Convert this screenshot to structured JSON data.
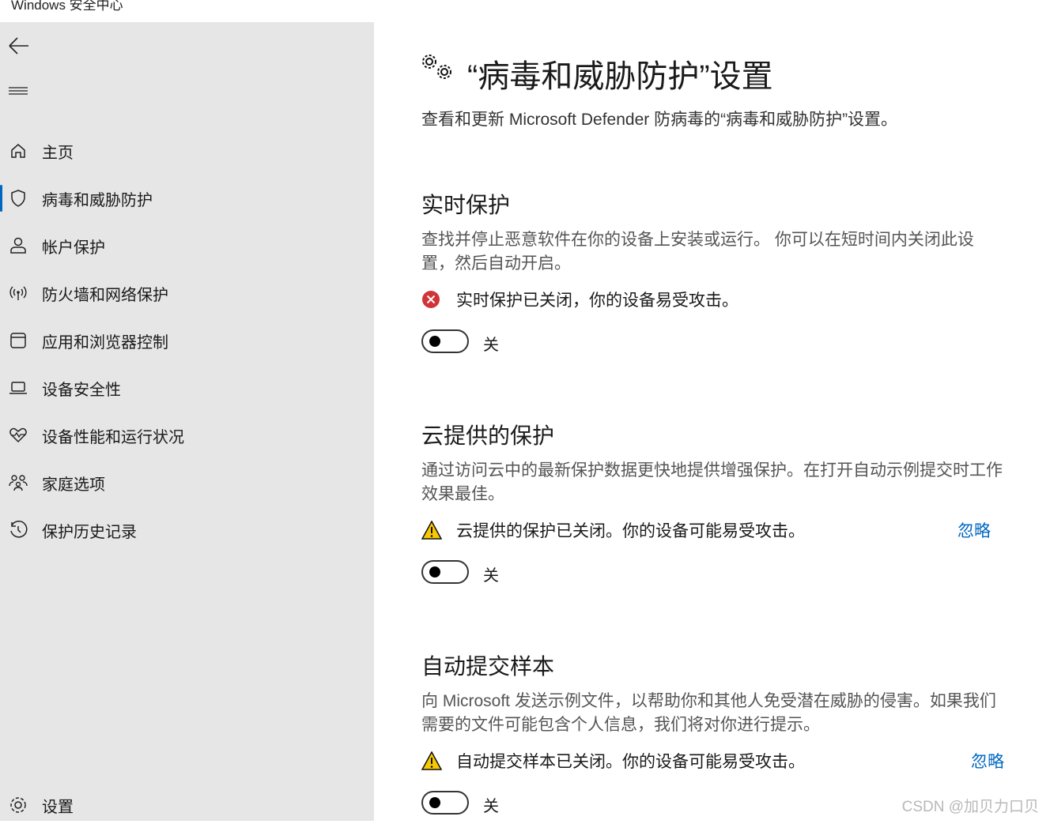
{
  "window": {
    "title": "Windows 安全中心"
  },
  "sidebar": {
    "items": [
      {
        "label": "主页",
        "icon": "home-icon"
      },
      {
        "label": "病毒和威胁防护",
        "icon": "shield-icon",
        "selected": true
      },
      {
        "label": "帐户保护",
        "icon": "person-icon"
      },
      {
        "label": "防火墙和网络保护",
        "icon": "wireless-icon"
      },
      {
        "label": "应用和浏览器控制",
        "icon": "app-window-icon"
      },
      {
        "label": "设备安全性",
        "icon": "laptop-icon"
      },
      {
        "label": "设备性能和运行状况",
        "icon": "heart-pulse-icon"
      },
      {
        "label": "家庭选项",
        "icon": "family-icon"
      },
      {
        "label": "保护历史记录",
        "icon": "history-icon"
      }
    ],
    "settings": "设置"
  },
  "main": {
    "title": "“病毒和威胁防护”设置",
    "subtitle": "查看和更新 Microsoft Defender 防病毒的“病毒和威胁防护”设置。",
    "sections": [
      {
        "heading": "实时保护",
        "desc": "查找并停止恶意软件在你的设备上安装或运行。 你可以在短时间内关闭此设置，然后自动开启。",
        "alert": "实时保护已关闭，你的设备易受攻击。",
        "alert_type": "error",
        "toggle_label": "关",
        "toggle_on": false
      },
      {
        "heading": "云提供的保护",
        "desc": "通过访问云中的最新保护数据更快地提供增强保护。在打开自动示例提交时工作效果最佳。",
        "alert": "云提供的保护已关闭。你的设备可能易受攻击。",
        "alert_type": "warning",
        "ignore": "忽略",
        "toggle_label": "关",
        "toggle_on": false
      },
      {
        "heading": "自动提交样本",
        "desc": "向 Microsoft 发送示例文件，以帮助你和其他人免受潜在威胁的侵害。如果我们需要的文件可能包含个人信息，我们将对你进行提示。",
        "alert": "自动提交样本已关闭。你的设备可能易受攻击。",
        "alert_type": "warning",
        "ignore": "忽略",
        "toggle_label": "关",
        "toggle_on": false
      }
    ]
  },
  "watermark": "CSDN @加贝力口贝",
  "colors": {
    "accent": "#0067c0",
    "error": "#d13438",
    "warning": "#f8c800",
    "sidebar": "#e6e6e6"
  }
}
